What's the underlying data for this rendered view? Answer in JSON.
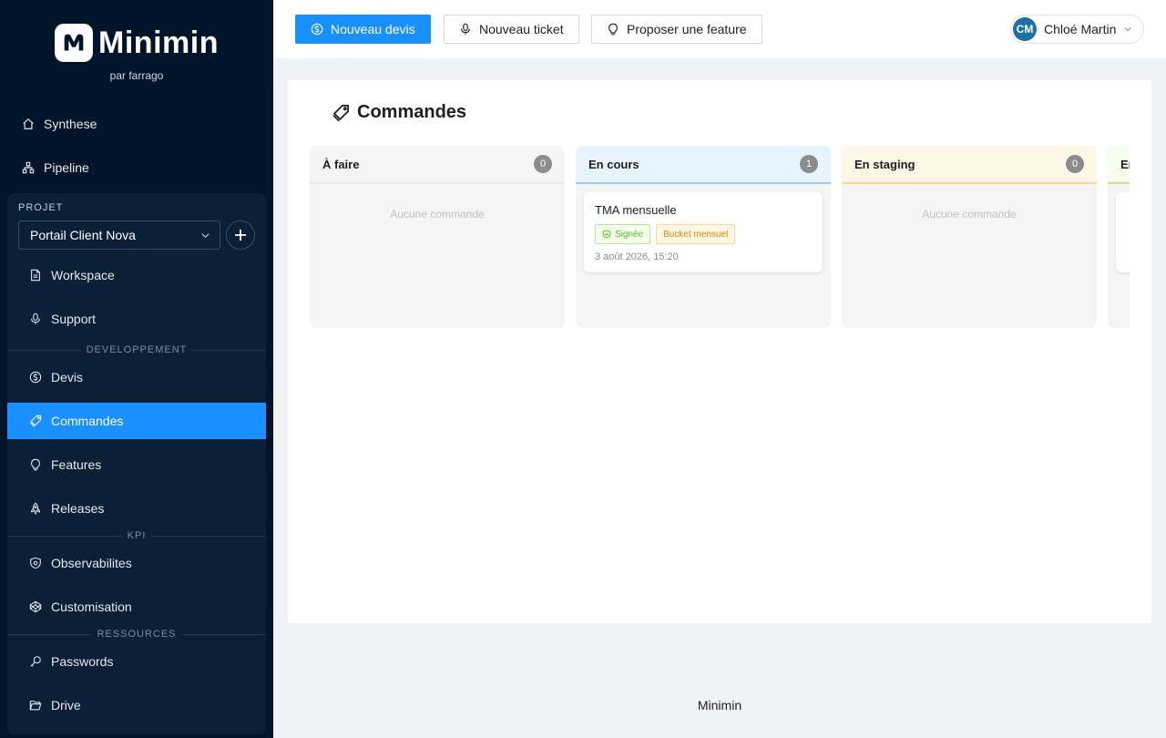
{
  "brand": {
    "name": "Minimin",
    "tagline": "par farrago"
  },
  "nav_top": [
    {
      "label": "Synthese",
      "icon": "home-icon"
    },
    {
      "label": "Pipeline",
      "icon": "pipeline-icon"
    }
  ],
  "project": {
    "section_label": "PROJET",
    "selected": "Portail Client Nova",
    "add_label": "+",
    "items": [
      {
        "label": "Workspace",
        "icon": "document-icon"
      },
      {
        "label": "Support",
        "icon": "microphone-icon"
      }
    ],
    "sections": [
      {
        "title": "DEVELOPPEMENT",
        "items": [
          {
            "label": "Devis",
            "icon": "dollar-icon"
          },
          {
            "label": "Commandes",
            "icon": "tags-icon",
            "active": true
          },
          {
            "label": "Features",
            "icon": "bulb-icon"
          },
          {
            "label": "Releases",
            "icon": "rocket-icon"
          }
        ]
      },
      {
        "title": "KPI",
        "items": [
          {
            "label": "Observabilites",
            "icon": "safety-icon"
          },
          {
            "label": "Customisation",
            "icon": "codepen-icon"
          }
        ]
      },
      {
        "title": "RESSOURCES",
        "items": [
          {
            "label": "Passwords",
            "icon": "key-icon"
          },
          {
            "label": "Drive",
            "icon": "folder-icon"
          }
        ]
      }
    ]
  },
  "topbar": {
    "new_quote": "Nouveau devis",
    "new_ticket": "Nouveau ticket",
    "propose_feature": "Proposer une feature",
    "user": {
      "initials": "CM",
      "name": "Chloé Martin"
    }
  },
  "page": {
    "title": "Commandes",
    "empty_text": "Aucune commande"
  },
  "columns": [
    {
      "title": "À faire",
      "count": "0",
      "color": "#e8e8e8"
    },
    {
      "title": "En cours",
      "count": "1",
      "color": "#91caff",
      "card": {
        "title": "TMA mensuelle",
        "tag_status": "Signée",
        "tag_type": "Bucket mensuel",
        "date": "3 août 2026, 15:20"
      }
    },
    {
      "title": "En staging",
      "count": "0",
      "color": "#ffd591"
    },
    {
      "title": "En production",
      "count": "",
      "color": "#b7eb8f"
    }
  ],
  "footer": "Minimin"
}
